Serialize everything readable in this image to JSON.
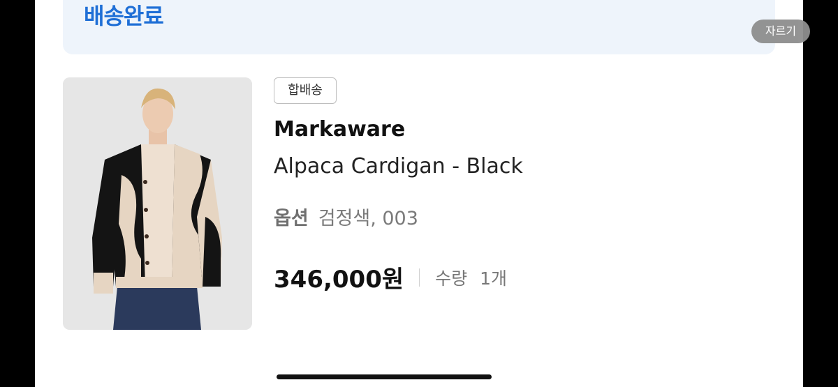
{
  "order_status": "배송완료",
  "crop_button_label": "자르기",
  "item": {
    "tag": "합배송",
    "brand": "Markaware",
    "name": "Alpaca Cardigan - Black",
    "option_label": "옵션",
    "option_value": "검정색, 003",
    "price": "346,000원",
    "quantity_label": "수량",
    "quantity_value": "1개"
  },
  "colors": {
    "status_blue": "#1f6fd6",
    "status_bg": "#eef4fb"
  }
}
